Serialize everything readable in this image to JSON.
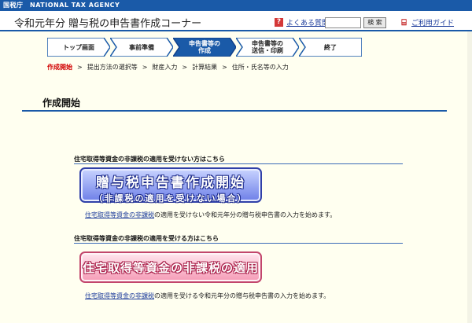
{
  "agency": "国税庁　NATIONAL TAX AGENCY",
  "header": {
    "title": "令和元年分 贈与税の申告書作成コーナー",
    "faq_icon": "?",
    "faq_label": "よくある質問",
    "search_placeholder": "",
    "search_button": "検 索",
    "guide_icon": "book-icon",
    "guide_label": "ご利用ガイド"
  },
  "steps": [
    {
      "line1": "トップ画面",
      "line2": ""
    },
    {
      "line1": "事前準備",
      "line2": ""
    },
    {
      "line1": "申告書等の",
      "line2": "作成"
    },
    {
      "line1": "申告書等の",
      "line2": "送信・印刷"
    },
    {
      "line1": "終了",
      "line2": ""
    }
  ],
  "breadcrumb": {
    "current": "作成開始",
    "items": [
      "提出方法の選択等",
      "財産入力",
      "計算結果",
      "住所・氏名等の入力"
    ],
    "separator": ">"
  },
  "page_title": "作成開始",
  "section1": {
    "heading": "住宅取得等資金の非課税の適用を受けない方はこちら",
    "button_line1": "贈与税申告書作成開始",
    "button_line2": "（非課税の適用を受けない場合）",
    "desc_link": "住宅取得等資金の非課税",
    "desc_rest": "の適用を受けない令和元年分の贈与税申告書の入力を始めます。"
  },
  "section2": {
    "heading": "住宅取得等資金の非課税の適用を受ける方はこちら",
    "button_line1": "住宅取得等資金の非課税の適用",
    "desc_link": "住宅取得等資金の非課税",
    "desc_rest": "の適用を受ける令和元年分の贈与税申告書の入力を始めます。"
  },
  "colors": {
    "brand": "#1a5aa8",
    "active_step": "#1a5aa8",
    "current_crumb": "#d10000"
  }
}
